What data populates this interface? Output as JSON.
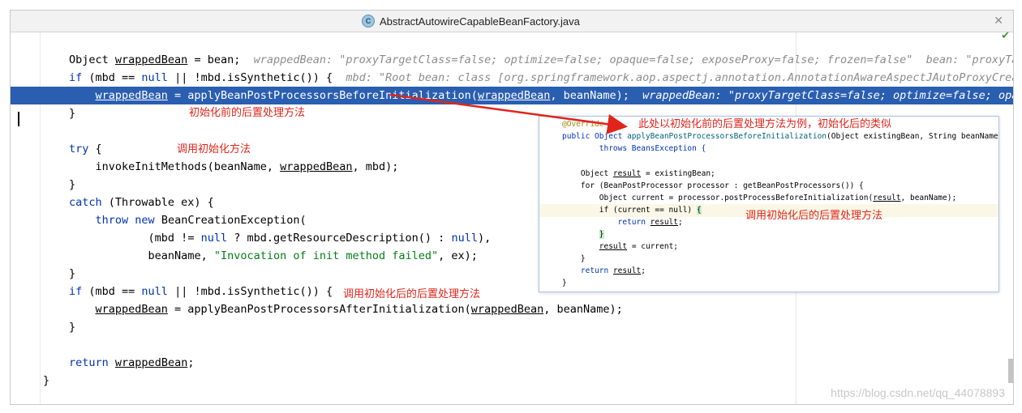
{
  "tab": {
    "icon": "C",
    "filename": "AbstractAutowireCapableBeanFactory.java",
    "close": "✕"
  },
  "status": {
    "check": "✔"
  },
  "code": {
    "l1": {
      "a": "Object ",
      "b": "wrappedBean",
      "c": " = bean;  ",
      "hint": "wrappedBean: \"proxyTargetClass=false; optimize=false; opaque=false; exposeProxy=false; frozen=false\"  bean: \"proxyTarg"
    },
    "l2": {
      "kw": "if",
      "a": " (mbd == ",
      "lit": "null",
      "b": " || !mbd.isSynthetic()) {  ",
      "hint": "mbd: \"Root bean: class [org.springframework.aop.aspectj.annotation.AnnotationAwareAspectJAutoProxyCreato"
    },
    "l3": {
      "indent": "    ",
      "a": "wrappedBean",
      "b": " = applyBeanPostProcessorsBeforeInitialization(",
      "c": "wrappedBean",
      "d": ", beanName);  ",
      "hint": "wrappedBean: \"proxyTargetClass=false; optimize=false; opaqu"
    },
    "l4": "}",
    "l6": {
      "kw": "try",
      "b": " {"
    },
    "l7": {
      "indent": "    ",
      "a": "invokeInitMethods(beanName, ",
      "b": "wrappedBean",
      "c": ", mbd);"
    },
    "l8": "}",
    "l9": {
      "kw": "catch",
      "b": " (Throwable ex) {"
    },
    "l10": {
      "indent": "    ",
      "kw1": "throw",
      "sp": " ",
      "kw2": "new",
      "b": " BeanCreationException("
    },
    "l11": {
      "indent": "            ",
      "a": "(mbd != ",
      "lit1": "null",
      "b": " ? mbd.getResourceDescription() : ",
      "lit2": "null",
      "c": "),"
    },
    "l12": {
      "indent": "            ",
      "a": "beanName, ",
      "str": "\"Invocation of init method failed\"",
      "b": ", ex);"
    },
    "l13": "}",
    "l14": {
      "kw": "if",
      "a": " (mbd == ",
      "lit": "null",
      "b": " || !mbd.isSynthetic()) {"
    },
    "l15": {
      "indent": "    ",
      "a": "wrappedBean",
      "b": " = applyBeanPostProcessorsAfterInitialization(",
      "c": "wrappedBean",
      "d": ", beanName);"
    },
    "l16": "}",
    "l18": {
      "kw": "return",
      "a": " ",
      "b": "wrappedBean",
      "c": ";"
    },
    "l19": "}"
  },
  "annotations": {
    "before": "初始化前的后置处理方法",
    "invoke": "调用初始化方法",
    "after": "调用初始化后的后置处理方法",
    "popup_title": "此处以初始化前的后置处理方法为例，初始化后的类似",
    "popup_call": "调用初始化后的后置处理方法"
  },
  "popup": {
    "p0": "@Override",
    "p1a": "public Object ",
    "p1fn": "applyBeanPostProcessorsBeforeInitialization",
    "p1b": "(Object existingBean, String beanName)",
    "p2": "        throws BeansException {",
    "p4a": "    Object ",
    "p4u": "result",
    "p4b": " = existingBean;",
    "p5": "    for (BeanPostProcessor processor : getBeanPostProcessors()) {",
    "p6a": "        Object current = processor.postProcessBeforeInitialization(",
    "p6u": "result",
    "p6b": ", beanName);",
    "p7a": "        if (current == null) ",
    "p7b": "{",
    "p8a": "            return ",
    "p8u": "result",
    "p8b": ";",
    "p9a": "        ",
    "p9b": "}",
    "p10a": "        ",
    "p10u": "result",
    "p10b": " = current;",
    "p11": "    }",
    "p12a": "    return ",
    "p12u": "result",
    "p12b": ";",
    "p13": "}"
  },
  "watermark": "https://blog.csdn.net/qq_44078893"
}
